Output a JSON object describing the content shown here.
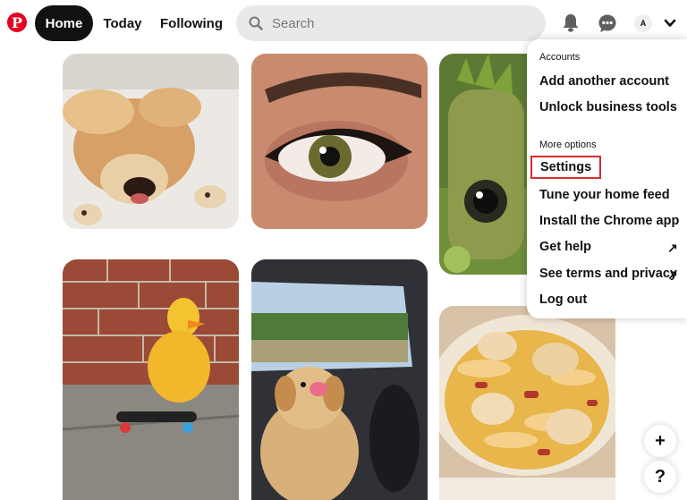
{
  "header": {
    "logo_letter": "P",
    "nav": {
      "home": "Home",
      "today": "Today",
      "following": "Following"
    },
    "search": {
      "placeholder": "Search"
    },
    "avatar_initial": "A"
  },
  "icons": {
    "logo": "pinterest-logo-icon",
    "search": "search-icon",
    "notifications": "bell-icon",
    "messages": "chat-bubble-icon",
    "account_menu": "chevron-down-icon",
    "external_link": "arrow-up-right-icon",
    "add": "plus-icon",
    "help": "question-icon"
  },
  "menu": {
    "accounts_heading": "Accounts",
    "add_account": "Add another account",
    "unlock_business": "Unlock business tools",
    "more_options_heading": "More options",
    "settings": "Settings",
    "tune_feed": "Tune your home feed",
    "install_app": "Install the Chrome app",
    "get_help": "Get help",
    "terms_privacy": "See terms and privacy",
    "log_out": "Log out",
    "external_arrow": "↗"
  },
  "pins": [
    {
      "subject": "dog-on-bed"
    },
    {
      "subject": "eye-makeup"
    },
    {
      "subject": "groot-figure"
    },
    {
      "subject": "duckling-skateboard"
    },
    {
      "subject": "puppy-in-car"
    },
    {
      "subject": "scallops-pasta"
    }
  ],
  "fab": {
    "add": "+",
    "help": "?"
  },
  "colors": {
    "brand": "#e60023",
    "highlight": "#d32f2f",
    "nav_active": "#111111",
    "search_bg": "#e9e9e9"
  }
}
